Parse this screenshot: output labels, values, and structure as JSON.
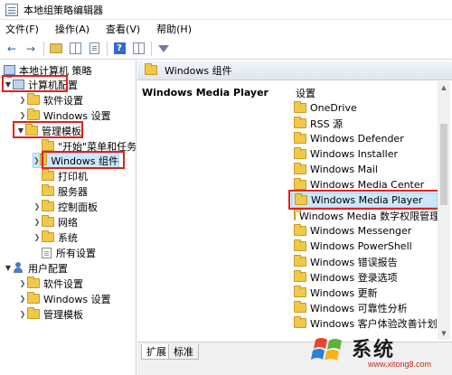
{
  "window": {
    "title": "本地组策略编辑器"
  },
  "menu": [
    {
      "label": "文件(F)"
    },
    {
      "label": "操作(A)"
    },
    {
      "label": "查看(V)"
    },
    {
      "label": "帮助(H)"
    }
  ],
  "tree": {
    "root": "本地计算机 策略",
    "computer_config": "计算机配置",
    "software_settings": "软件设置",
    "windows_settings": "Windows 设置",
    "admin_templates": "管理模板",
    "start_menu": "\"开始\"菜单和任务",
    "windows_components": "Windows 组件",
    "printers": "打印机",
    "server": "服务器",
    "control_panel": "控制面板",
    "network": "网络",
    "system": "系统",
    "all_settings": "所有设置",
    "user_config": "用户配置",
    "user_software_settings": "软件设置",
    "user_windows_settings": "Windows 设置",
    "user_admin_templates": "管理模板"
  },
  "right_pane": {
    "header": "Windows 组件",
    "description_title": "Windows Media Player",
    "column_header": "设置",
    "items": [
      {
        "label": "OneDrive"
      },
      {
        "label": "RSS 源"
      },
      {
        "label": "Windows Defender"
      },
      {
        "label": "Windows Installer"
      },
      {
        "label": "Windows Mail"
      },
      {
        "label": "Windows Media Center"
      },
      {
        "label": "Windows Media Player"
      },
      {
        "label": "Windows Media 数字权限管理"
      },
      {
        "label": "Windows Messenger"
      },
      {
        "label": "Windows PowerShell"
      },
      {
        "label": "Windows 错误报告"
      },
      {
        "label": "Windows 登录选项"
      },
      {
        "label": "Windows 更新"
      },
      {
        "label": "Windows 可靠性分析"
      },
      {
        "label": "Windows 客户体验改善计划"
      }
    ],
    "selected_item": "Windows Media Player"
  },
  "tabs": [
    {
      "label": "扩展"
    },
    {
      "label": "标准"
    }
  ],
  "watermark": {
    "brand": "系统",
    "url": "www.xitong8.com"
  },
  "colors": {
    "highlight_red": "#e0201d",
    "selection_blue": "#cce8ff",
    "folder_yellow": "#f0c94a"
  }
}
